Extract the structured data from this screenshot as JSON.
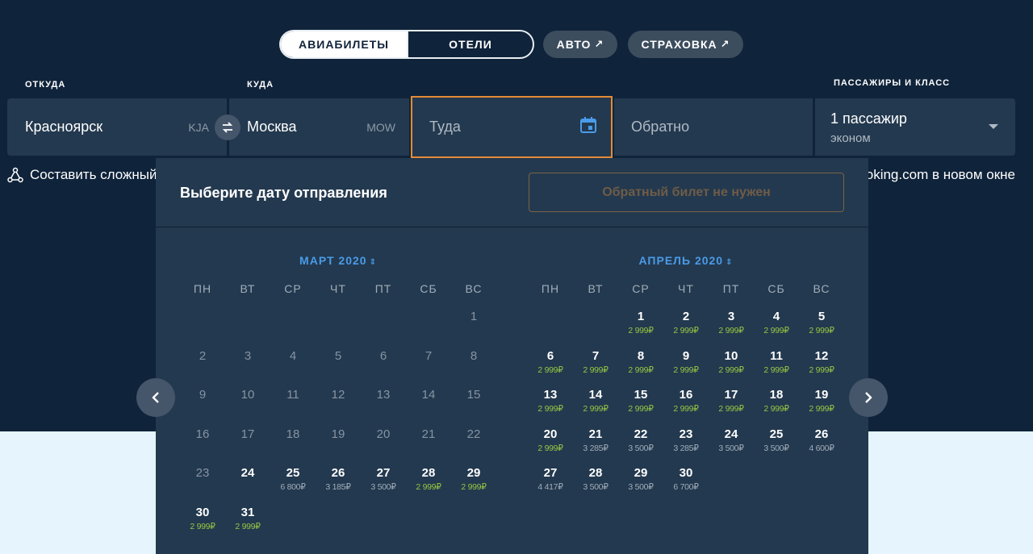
{
  "tabs": {
    "flights": "АВИАБИЛЕТЫ",
    "hotels": "ОТЕЛИ",
    "auto": "АВТО",
    "insurance": "СТРАХОВКА",
    "external_arrow": "↗"
  },
  "search": {
    "from_label": "ОТКУДА",
    "to_label": "КУДА",
    "passengers_label": "ПАССАЖИРЫ И КЛАСС",
    "from_city": "Красноярск",
    "from_code": "KJA",
    "to_city": "Москва",
    "to_code": "MOW",
    "depart_placeholder": "Туда",
    "return_placeholder": "Обратно",
    "passengers": "1 пассажир",
    "cabin_class": "эконом"
  },
  "links": {
    "complex_route": "Составить сложный",
    "booking": "Booking.com в новом окне"
  },
  "calendar": {
    "title": "Выберите дату отправления",
    "no_return_button": "Обратный билет не нужен",
    "weekdays": [
      "ПН",
      "ВТ",
      "СР",
      "ЧТ",
      "ПТ",
      "СБ",
      "ВС"
    ],
    "months": [
      {
        "title": "МАРТ 2020",
        "offset": 6,
        "days": [
          {
            "d": "1",
            "past": true
          },
          {
            "d": "2",
            "past": true
          },
          {
            "d": "3",
            "past": true
          },
          {
            "d": "4",
            "past": true
          },
          {
            "d": "5",
            "past": true
          },
          {
            "d": "6",
            "past": true
          },
          {
            "d": "7",
            "past": true
          },
          {
            "d": "8",
            "past": true
          },
          {
            "d": "9",
            "past": true
          },
          {
            "d": "10",
            "past": true
          },
          {
            "d": "11",
            "past": true
          },
          {
            "d": "12",
            "past": true
          },
          {
            "d": "13",
            "past": true
          },
          {
            "d": "14",
            "past": true
          },
          {
            "d": "15",
            "past": true
          },
          {
            "d": "16",
            "past": true
          },
          {
            "d": "17",
            "past": true
          },
          {
            "d": "18",
            "past": true
          },
          {
            "d": "19",
            "past": true
          },
          {
            "d": "20",
            "past": true
          },
          {
            "d": "21",
            "past": true
          },
          {
            "d": "22",
            "past": true
          },
          {
            "d": "23",
            "past": true
          },
          {
            "d": "24"
          },
          {
            "d": "25",
            "price": "6 800₽"
          },
          {
            "d": "26",
            "price": "3 185₽"
          },
          {
            "d": "27",
            "price": "3 500₽"
          },
          {
            "d": "28",
            "price": "2 999₽",
            "cheap": true
          },
          {
            "d": "29",
            "price": "2 999₽",
            "cheap": true
          },
          {
            "d": "30",
            "price": "2 999₽",
            "cheap": true
          },
          {
            "d": "31",
            "price": "2 999₽",
            "cheap": true
          }
        ]
      },
      {
        "title": "АПРЕЛЬ 2020",
        "offset": 2,
        "days": [
          {
            "d": "1",
            "price": "2 999₽",
            "cheap": true
          },
          {
            "d": "2",
            "price": "2 999₽",
            "cheap": true
          },
          {
            "d": "3",
            "price": "2 999₽",
            "cheap": true
          },
          {
            "d": "4",
            "price": "2 999₽",
            "cheap": true
          },
          {
            "d": "5",
            "price": "2 999₽",
            "cheap": true
          },
          {
            "d": "6",
            "price": "2 999₽",
            "cheap": true
          },
          {
            "d": "7",
            "price": "2 999₽",
            "cheap": true
          },
          {
            "d": "8",
            "price": "2 999₽",
            "cheap": true
          },
          {
            "d": "9",
            "price": "2 999₽",
            "cheap": true
          },
          {
            "d": "10",
            "price": "2 999₽",
            "cheap": true
          },
          {
            "d": "11",
            "price": "2 999₽",
            "cheap": true
          },
          {
            "d": "12",
            "price": "2 999₽",
            "cheap": true
          },
          {
            "d": "13",
            "price": "2 999₽",
            "cheap": true
          },
          {
            "d": "14",
            "price": "2 999₽",
            "cheap": true
          },
          {
            "d": "15",
            "price": "2 999₽",
            "cheap": true
          },
          {
            "d": "16",
            "price": "2 999₽",
            "cheap": true
          },
          {
            "d": "17",
            "price": "2 999₽",
            "cheap": true
          },
          {
            "d": "18",
            "price": "2 999₽",
            "cheap": true
          },
          {
            "d": "19",
            "price": "2 999₽",
            "cheap": true
          },
          {
            "d": "20",
            "price": "2 999₽",
            "cheap": true
          },
          {
            "d": "21",
            "price": "3 285₽"
          },
          {
            "d": "22",
            "price": "3 500₽"
          },
          {
            "d": "23",
            "price": "3 285₽"
          },
          {
            "d": "24",
            "price": "3 500₽"
          },
          {
            "d": "25",
            "price": "3 500₽"
          },
          {
            "d": "26",
            "price": "4 600₽"
          },
          {
            "d": "27",
            "price": "4 417₽"
          },
          {
            "d": "28",
            "price": "3 500₽"
          },
          {
            "d": "29",
            "price": "3 500₽"
          },
          {
            "d": "30",
            "price": "6 700₽"
          }
        ]
      }
    ]
  },
  "colors": {
    "background": "#0f233a",
    "field": "#23394f",
    "accent": "#4a9be8",
    "active_border": "#e48a37",
    "cheap_price": "#94c743"
  }
}
